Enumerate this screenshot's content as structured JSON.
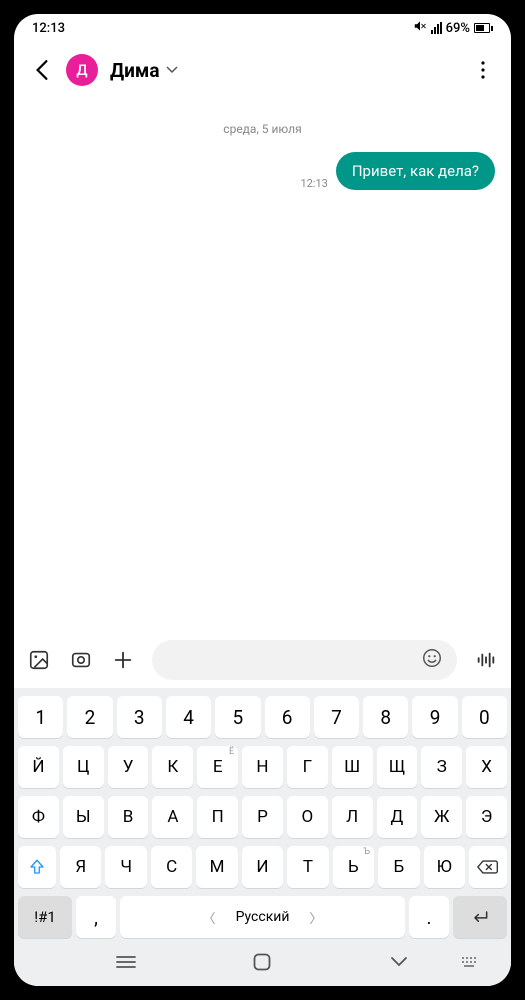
{
  "status": {
    "time": "12:13",
    "battery_pct": "69%"
  },
  "header": {
    "avatar_initial": "Д",
    "contact_name": "Дима"
  },
  "chat": {
    "date_label": "среда, 5 июля",
    "messages": [
      {
        "time": "12:13",
        "text": "Привет, как дела?"
      }
    ]
  },
  "keyboard": {
    "row_numbers": [
      "1",
      "2",
      "3",
      "4",
      "5",
      "6",
      "7",
      "8",
      "9",
      "0"
    ],
    "row_letters_1": [
      "Й",
      "Ц",
      "У",
      "К",
      "Е",
      "Н",
      "Г",
      "Ш",
      "Щ",
      "З",
      "Х"
    ],
    "row_letters_1_hints": {
      "4": "Ё"
    },
    "row_letters_2": [
      "Ф",
      "Ы",
      "В",
      "А",
      "П",
      "Р",
      "О",
      "Л",
      "Д",
      "Ж",
      "Э"
    ],
    "row_letters_3": [
      "Я",
      "Ч",
      "С",
      "М",
      "И",
      "Т",
      "Ь",
      "Б",
      "Ю"
    ],
    "row_letters_3_hints": {
      "6": "Ъ"
    },
    "symbols_key": "!#1",
    "comma_key": ",",
    "language_label": "Русский",
    "period_key": "."
  }
}
